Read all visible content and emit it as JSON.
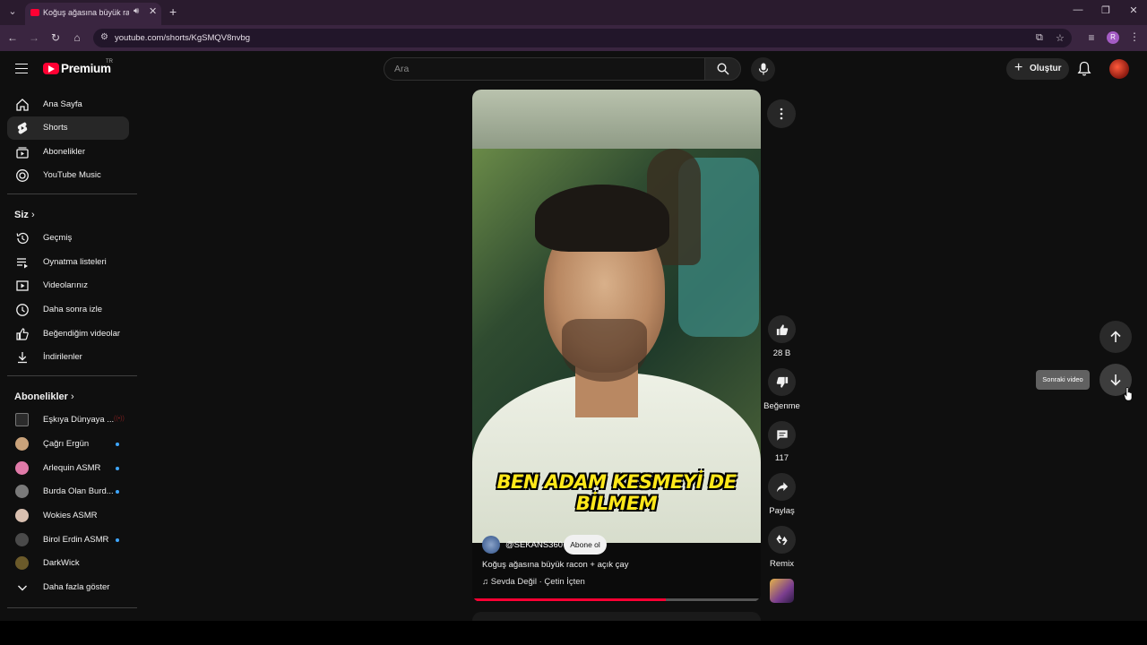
{
  "browser": {
    "tab_title": "Koğuş ağasına büyük racon",
    "url": "youtube.com/shorts/KgSMQV8nvbg",
    "profile_initial": "R"
  },
  "header": {
    "logo_text": "Premium",
    "country_code": "TR",
    "search_placeholder": "Ara",
    "create_label": "Oluştur"
  },
  "sidebar": {
    "main_items": [
      {
        "label": "Ana Sayfa",
        "icon": "home-icon"
      },
      {
        "label": "Shorts",
        "icon": "shorts-icon",
        "active": true
      },
      {
        "label": "Abonelikler",
        "icon": "subscriptions-icon"
      },
      {
        "label": "YouTube Music",
        "icon": "music-icon"
      }
    ],
    "you_heading": "Siz",
    "you_items": [
      {
        "label": "Geçmiş",
        "icon": "history-icon"
      },
      {
        "label": "Oynatma listeleri",
        "icon": "playlists-icon"
      },
      {
        "label": "Videolarınız",
        "icon": "your-videos-icon"
      },
      {
        "label": "Daha sonra izle",
        "icon": "watch-later-icon"
      },
      {
        "label": "Beğendiğim videolar",
        "icon": "liked-icon"
      },
      {
        "label": "İndirilenler",
        "icon": "download-icon"
      }
    ],
    "subs_heading": "Abonelikler",
    "subscriptions": [
      {
        "name": "Eşkıya Dünyaya ...",
        "color": "#2b2b2b",
        "badge": "((•))"
      },
      {
        "name": "Çağrı Ergün",
        "color": "#c9a27a",
        "dot": true
      },
      {
        "name": "Arlequin ASMR",
        "color": "#e07aa8",
        "dot": true
      },
      {
        "name": "Burda Olan Burd...",
        "color": "#7a7a7a",
        "dot": true
      },
      {
        "name": "Wokies ASMR",
        "color": "#d9c0b0",
        "dot": false
      },
      {
        "name": "Birol Erdin ASMR",
        "color": "#4a4a4a",
        "dot": true
      },
      {
        "name": "DarkWick",
        "color": "#6b5a2a",
        "dot": false
      }
    ],
    "show_more": "Daha fazla göster"
  },
  "short": {
    "caption": "BEN ADAM KESMEYİ DE BİLMEM",
    "channel": "@SEKANS360",
    "subscribe_label": "Abone ol",
    "title": "Koğuş ağasına büyük racon + açık çay",
    "music": "♫ Sevda Değil · Çetin İçten",
    "progress": 0.67
  },
  "actions": {
    "like_count": "28 B",
    "dislike_label": "Beğenme",
    "comment_count": "117",
    "share_label": "Paylaş",
    "remix_label": "Remix"
  },
  "navigation": {
    "tooltip": "Sonraki video"
  }
}
